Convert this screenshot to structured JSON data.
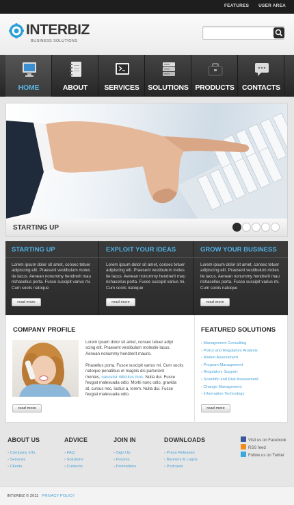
{
  "topbar": {
    "links": [
      "FEATURES",
      "USER AREA"
    ]
  },
  "header": {
    "logo_text": "INTERBIZ",
    "logo_sub": "BUSINESS SOLUTIONS",
    "search_placeholder": ""
  },
  "nav": {
    "items": [
      {
        "label": "HOME",
        "icon": "monitor-icon",
        "active": true
      },
      {
        "label": "ABOUT",
        "icon": "notebook-icon",
        "active": false
      },
      {
        "label": "SERVICES",
        "icon": "terminal-icon",
        "active": false
      },
      {
        "label": "SOLUTIONS",
        "icon": "server-icon",
        "active": false
      },
      {
        "label": "PRODUCTS",
        "icon": "briefcase-icon",
        "active": false
      },
      {
        "label": "CONTACTS",
        "icon": "chat-icon",
        "active": false
      }
    ]
  },
  "slider": {
    "caption": "STARTING UP",
    "slide_count": 5,
    "active_slide": 1
  },
  "features": [
    {
      "title": "STARTING UP",
      "lines": [
        "Lorem ipsum dolor sit amet, consec tetuer",
        "adipiscing elit. Praesent vestibulum moles",
        "tie lacus. Aenean nonummy hendrerit mau",
        "rishasellus porta. Fusce suscipit varius mi.",
        "Cum sociis natoque"
      ],
      "button": "read more"
    },
    {
      "title": "EXPLOIT YOUR IDEAS",
      "lines": [
        "Lorem ipsum dolor sit amet, consec tetuer",
        "adipiscing elit. Praesent vestibulum moles",
        "tie lacus. Aenean nonummy hendrerit mau",
        "rishasellus porta. Fusce suscipit varius mi.",
        "Cum sociis natoque"
      ],
      "button": "read more"
    },
    {
      "title": "GROW YOUR BUSINESS",
      "lines": [
        "Lorem ipsum dolor sit amet, consec tetuer",
        "adipiscing elit. Praesent vestibulum moles",
        "tie lacus. Aenean nonummy hendrerit mau",
        "rishasellus porta. Fusce suscipit varius mi.",
        "Cum sociis natoque"
      ],
      "button": "read more"
    }
  ],
  "profile": {
    "title": "COMPANY PROFILE",
    "para1": [
      "Lorem ipsum dolor sit amet, consec tetuer adipi",
      "scing elit. Praesent vestibulum molestie lacus.",
      "Aenean nonummy hendrerit mauris."
    ],
    "para2_line1": "Phasellus porta. Fusce suscipit varius mi. Cum sociis",
    "para2_line2": "natoque penatibus et magnis dis parturient",
    "para2_line3_start": "montes, ",
    "para2_link": "nascetur ridiculus mus",
    "para2_line3_end": ". Nulla dui. Fusce",
    "para2_line4": "feugiat malesuada odio. Morbi nunc odio, gravida",
    "para2_line5": "at, cursus nec, luctus a, lorem. Nulla dui. Fusce",
    "para2_line6": "feugiat malesuada odio.",
    "button": "read more"
  },
  "solutions": {
    "title": "FEATURED SOLUTIONS",
    "items": [
      "Management Consulting",
      "Policy and Regulatory Analysis",
      "Market Assessment",
      "Program Management",
      "Regulatory Support",
      "Scientific and Risk Assessment",
      "Change Management",
      "Information Technology"
    ],
    "button": "read more"
  },
  "footer": {
    "columns": [
      {
        "title": "ABOUT US",
        "links": [
          "Company Info",
          "Services",
          "Clients"
        ]
      },
      {
        "title": "ADVICE",
        "links": [
          "FAQ",
          "Solutions",
          "Contacts"
        ]
      },
      {
        "title": "JOIN IN",
        "links": [
          "Sign Up",
          "Forums",
          "Promotions"
        ]
      },
      {
        "title": "DOWNLOADS",
        "links": [
          "Press Releases",
          "Banners & Logos",
          "Podcasts"
        ]
      }
    ],
    "social": [
      {
        "label": "Visit us on Facebook",
        "icon": "facebook-icon",
        "color": "#3b5998"
      },
      {
        "label": "RSS feed",
        "icon": "rss-icon",
        "color": "#f28c1d"
      },
      {
        "label": "Follow us on Twitter",
        "icon": "twitter-icon",
        "color": "#3aa8dc"
      }
    ]
  },
  "bottom": {
    "copyright": "INTERBIZ © 2011",
    "privacy": "PRIVACY POLICY"
  },
  "colors": {
    "accent": "#4aa3d8",
    "dark": "#2b2b2b",
    "nav_active": "#5ab2e1"
  }
}
